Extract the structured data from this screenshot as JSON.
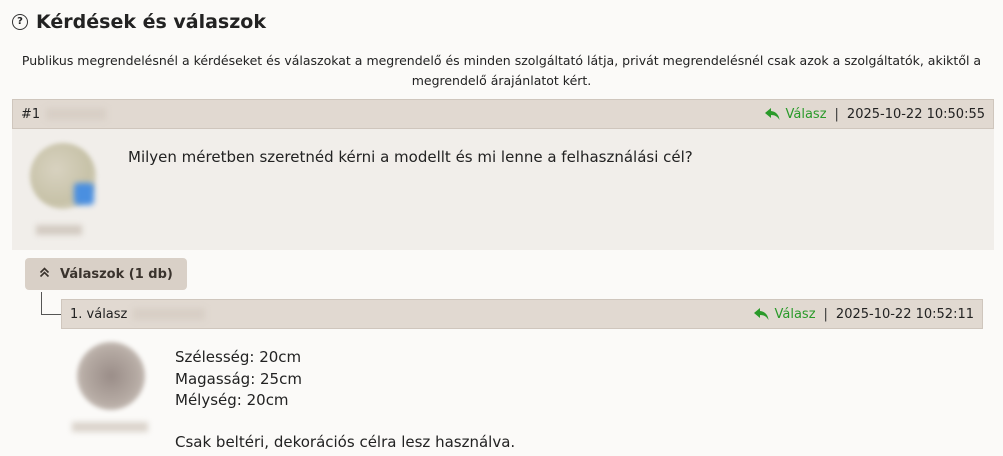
{
  "section": {
    "title": "Kérdések és válaszok",
    "notice": "Publikus megrendelésnél a kérdéseket és válaszokat a megrendelő és minden szolgáltató látja, privát megrendelésnél csak azok a szolgáltatók, akiktől a megrendelő árajánlatot kért."
  },
  "question": {
    "number": "#1",
    "reply_label": "Válasz",
    "separator": "|",
    "timestamp": "2025-10-22 10:50:55",
    "text": "Milyen méretben szeretnéd kérni a modellt és mi lenne a felhasználási cél?"
  },
  "answers_toggle": {
    "label": "Válaszok (1 db)"
  },
  "answer": {
    "number": "1. válasz",
    "reply_label": "Válasz",
    "separator": "|",
    "timestamp": "2025-10-22 10:52:11",
    "lines": [
      "Szélesség: 20cm",
      "Magasság: 25cm",
      "Mélység: 20cm",
      "Csak beltéri, dekorációs célra lesz használva."
    ]
  },
  "colors": {
    "reply_green": "#2a9a2a",
    "header_bg": "#e1d9d1",
    "body_bg": "#f1eeea"
  }
}
